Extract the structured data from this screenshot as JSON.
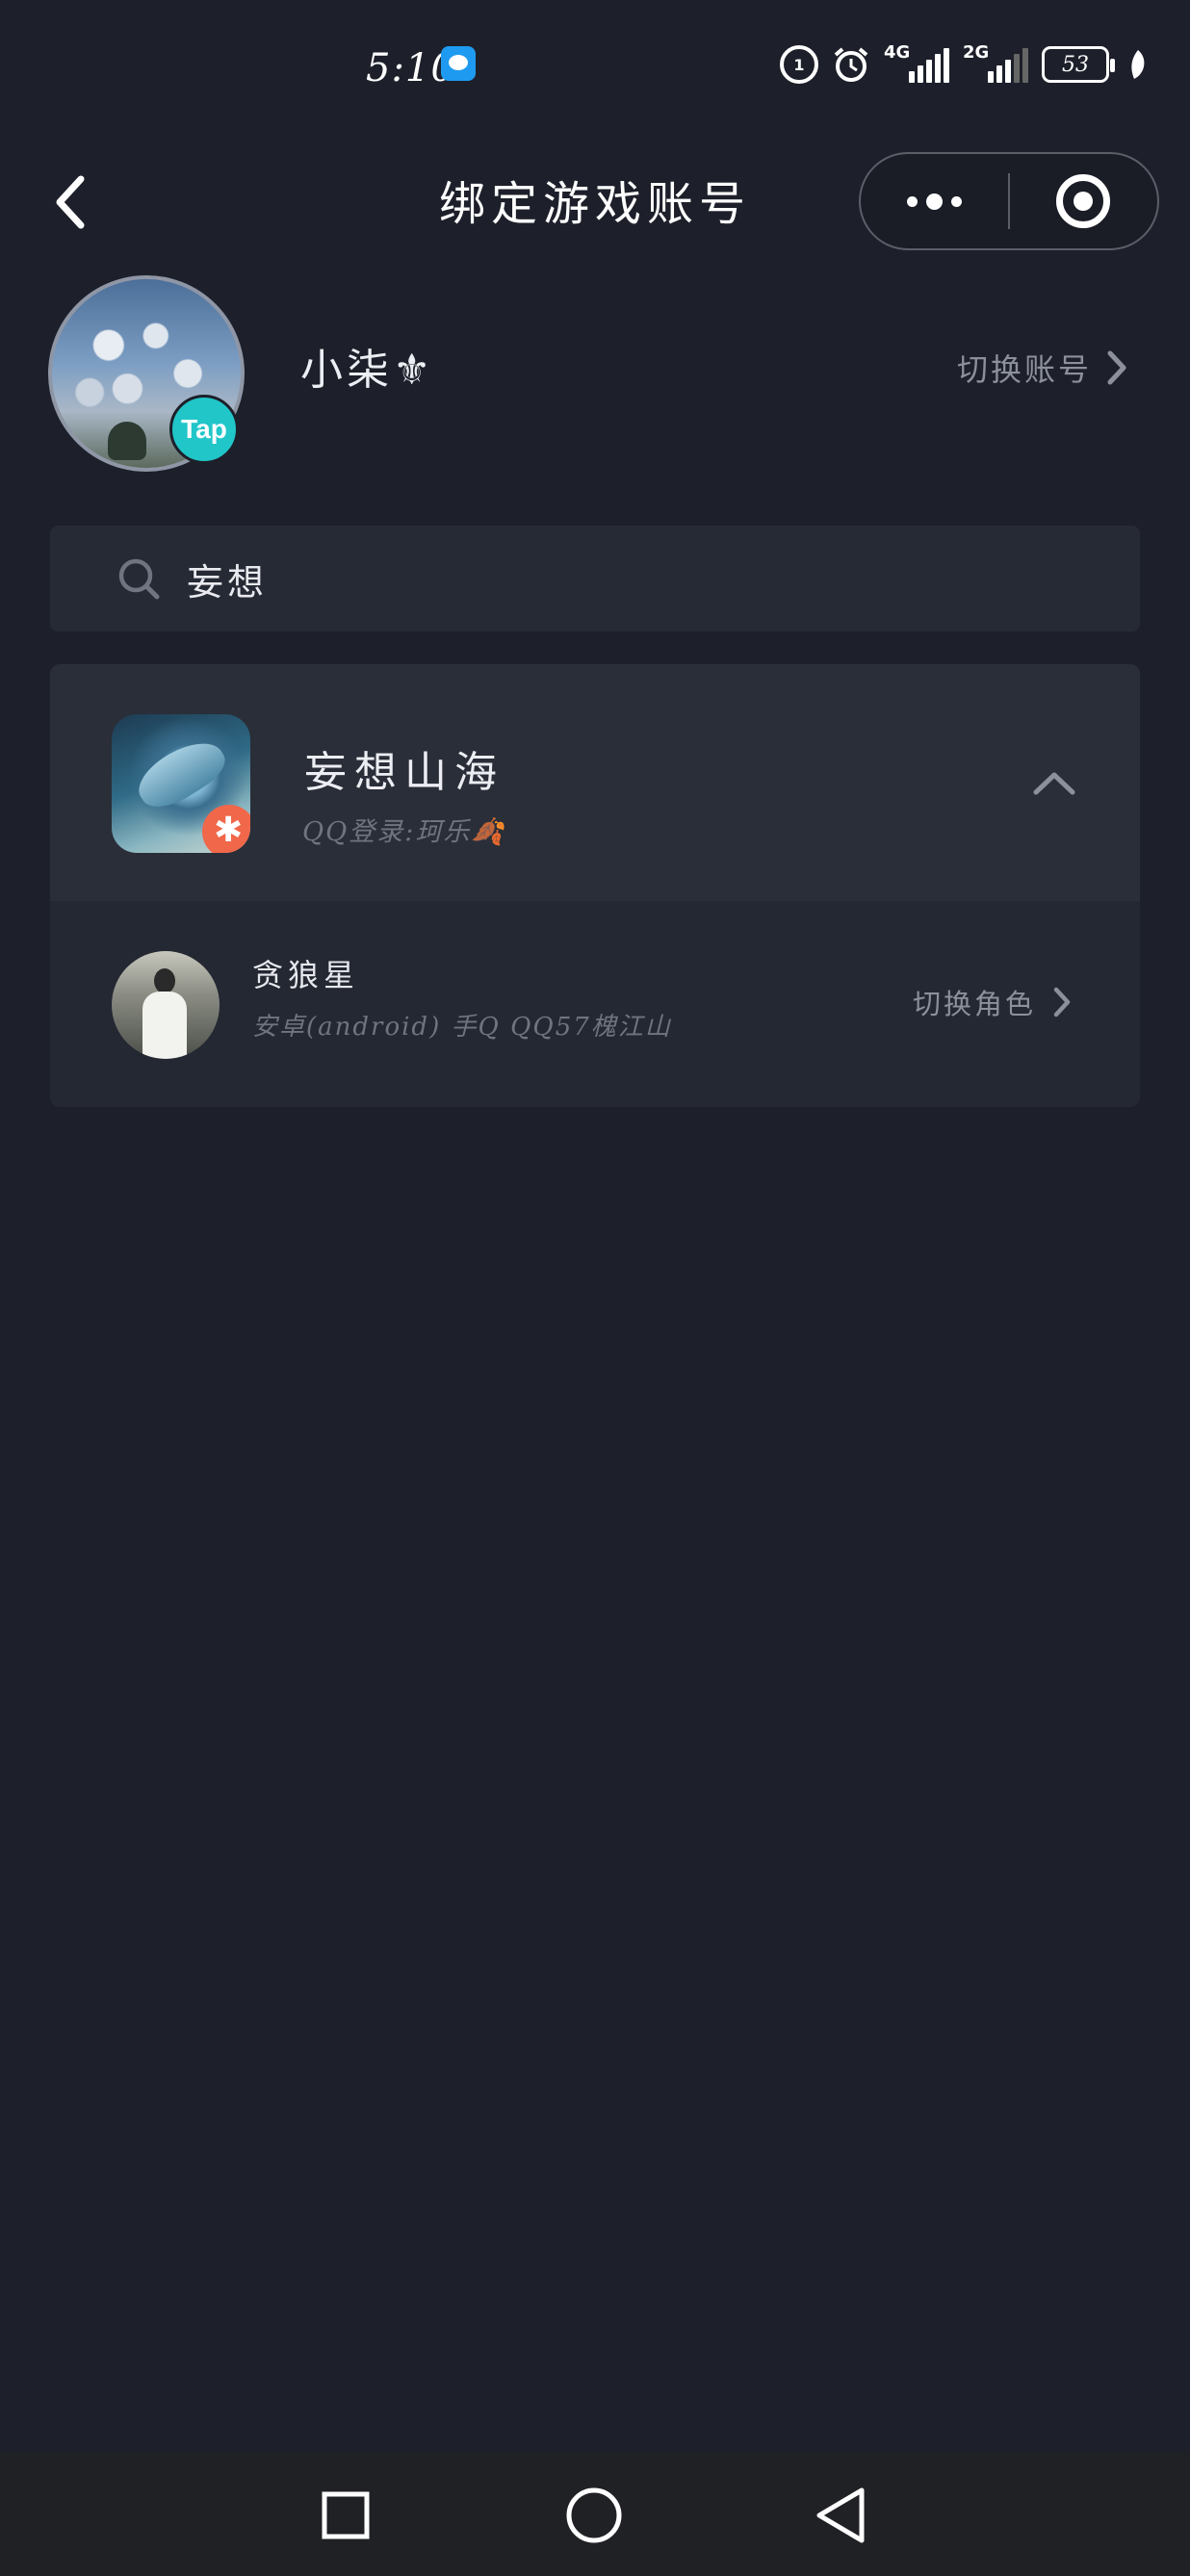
{
  "status_bar": {
    "time": "5:10",
    "network_1": "4G",
    "network_2": "2G",
    "battery": "53"
  },
  "nav": {
    "title": "绑定游戏账号",
    "back_icon": "chevron-left-icon",
    "more_icon": "more-dots-icon",
    "close_icon": "target-circle-icon"
  },
  "profile": {
    "username": "小柒⚜",
    "badge": "Tap",
    "switch_account_label": "切换账号"
  },
  "search": {
    "value": "妄想",
    "icon": "search-icon"
  },
  "game": {
    "name": "妄想山海",
    "login_info": "QQ登录:珂乐🍂",
    "expanded": true,
    "roles": [
      {
        "name": "贪狼星",
        "detail": "安卓(android) 手Q QQ57槐江山",
        "switch_label": "切换角色"
      }
    ]
  },
  "system_nav": {
    "recent_icon": "square-icon",
    "home_icon": "circle-icon",
    "back_icon": "triangle-back-icon"
  },
  "colors": {
    "background": "#1d202a",
    "card": "#242832",
    "card_header": "#2a2e38",
    "tap_badge": "#21c6c9",
    "muted_text": "#8c909b"
  }
}
